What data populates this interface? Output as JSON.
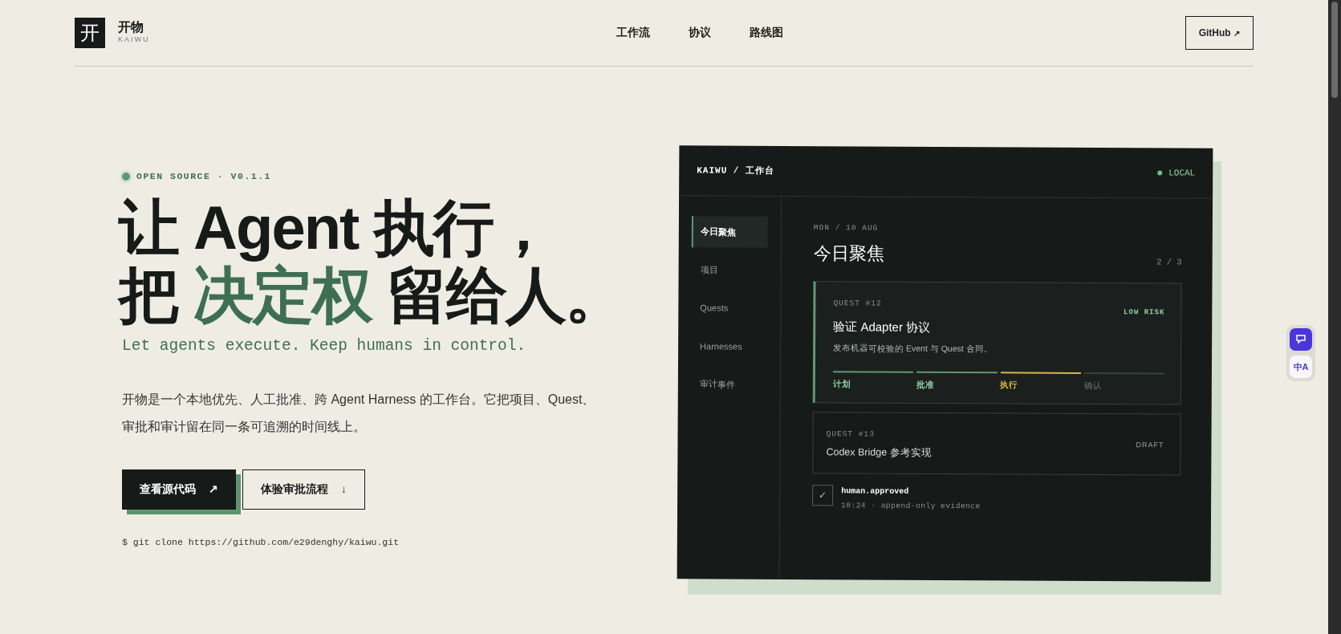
{
  "brand": {
    "mark": "开",
    "name": "开物",
    "sub": "KAIWU"
  },
  "nav": [
    "工作流",
    "协议",
    "路线图"
  ],
  "github_button": {
    "label": "GitHub",
    "icon": "↗"
  },
  "hero": {
    "badge": "OPEN SOURCE · V0.1.1",
    "headline": [
      [
        {
          "text": "让 Agent 执行，",
          "accent": false
        }
      ],
      [
        {
          "text": "把 ",
          "accent": false
        },
        {
          "text": "决定权",
          "accent": true
        },
        {
          "text": " 留给人。",
          "accent": false
        }
      ]
    ],
    "tagline": "Let agents execute. Keep humans in control.",
    "description": "开物是一个本地优先、人工批准、跨 Agent Harness 的工作台。它把项目、Quest、审批和审计留在同一条可追溯的时间线上。",
    "buttons": [
      {
        "kind": "primary",
        "label": "查看源代码",
        "icon": "↗"
      },
      {
        "kind": "outline",
        "label": "体验审批流程",
        "icon": "↓"
      }
    ],
    "clone_command": "$ git clone https://github.com/e29denghy/kaiwu.git"
  },
  "app": {
    "title": "KAIWU / 工作台",
    "status": "LOCAL",
    "sidebar": [
      {
        "label": "今日聚焦",
        "selected": true
      },
      {
        "label": "项目",
        "selected": false
      },
      {
        "label": "Quests",
        "selected": false
      },
      {
        "label": "Harnesses",
        "selected": false
      },
      {
        "label": "审计事件",
        "selected": false
      }
    ],
    "date": "MON / 10 AUG",
    "heading": "今日聚焦",
    "pager": "2 / 3",
    "quests": [
      {
        "id": "QUEST #12",
        "title": "验证 Adapter 协议",
        "description": "发布机器可校验的 Event 与 Quest 合同。",
        "tag": "LOW RISK",
        "active": true,
        "steps": [
          {
            "label": "计划",
            "kind": "done"
          },
          {
            "label": "批准",
            "kind": "done"
          },
          {
            "label": "执行",
            "kind": "current"
          },
          {
            "label": "确认",
            "kind": "pending"
          }
        ]
      },
      {
        "id": "QUEST #13",
        "title": "Codex Bridge 参考实现",
        "tag": "DRAFT",
        "active": false
      }
    ],
    "event": {
      "checked": true,
      "mark": "✓",
      "name": "human.approved",
      "meta": "10:24 · append-only evidence"
    }
  },
  "floating_tools": [
    {
      "kind": "chat"
    },
    {
      "kind": "translate",
      "label": "中A"
    }
  ]
}
